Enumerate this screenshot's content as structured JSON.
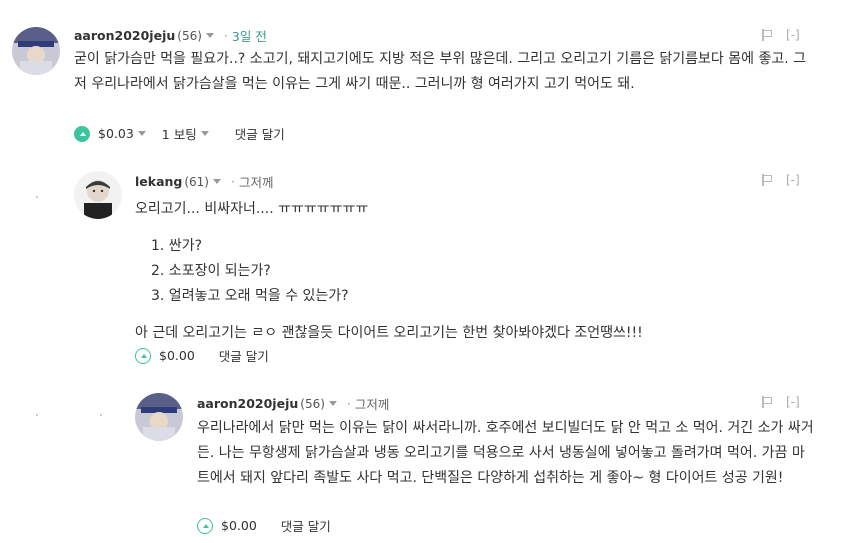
{
  "comments": [
    {
      "author": "aaron2020jeju",
      "reputation": "(56)",
      "time": "3일 전",
      "body": "굳이 닭가슴만 먹을 필요가..? 소고기, 돼지고기에도 지방 적은 부위 많은데. 그리고 오리고기 기름은 닭기름보다 몸에 좋고. 그저 우리나라에서 닭가슴살을 먹는 이유는 그게 싸기 때문.. 그러니까 형 여러가지 고기 먹어도 돼.",
      "payout": "$0.03",
      "votes": "1 보팅",
      "reply": "댓글 달기",
      "collapse": "[-]"
    },
    {
      "author": "lekang",
      "reputation": "(61)",
      "time": "그저께",
      "body_intro": "오리고기... 비싸자너.... ㅠㅠㅠㅠㅠㅠㅠ",
      "list": [
        "1. 싼가?",
        "2. 소포장이 되는가?",
        "3. 얼려놓고 오래 먹을 수 있는가?"
      ],
      "body_outro": "아 근데 오리고기는 ㄹㅇ 괜찮을듯 다이어트 오리고기는 한번 찾아봐야겠다 조언땡쓰!!!",
      "payout": "$0.00",
      "reply": "댓글 달기",
      "collapse": "[-]"
    },
    {
      "author": "aaron2020jeju",
      "reputation": "(56)",
      "time": "그저께",
      "body": "우리나라에서 닭만 먹는 이유는 닭이 싸서라니까. 호주에선 보디빌더도 닭 안 먹고 소 먹어. 거긴 소가 싸거든. 나는 무항생제 닭가슴살과 냉동 오리고기를 덕용으로 사서 냉동실에 넣어놓고 돌려가며 먹어. 가끔 마트에서 돼지 앞다리 족발도 사다 먹고. 단백질은 다양하게 섭취하는 게 좋아~ 형 다이어트 성공 기원!",
      "payout": "$0.00",
      "reply": "댓글 달기",
      "collapse": "[-]"
    }
  ]
}
